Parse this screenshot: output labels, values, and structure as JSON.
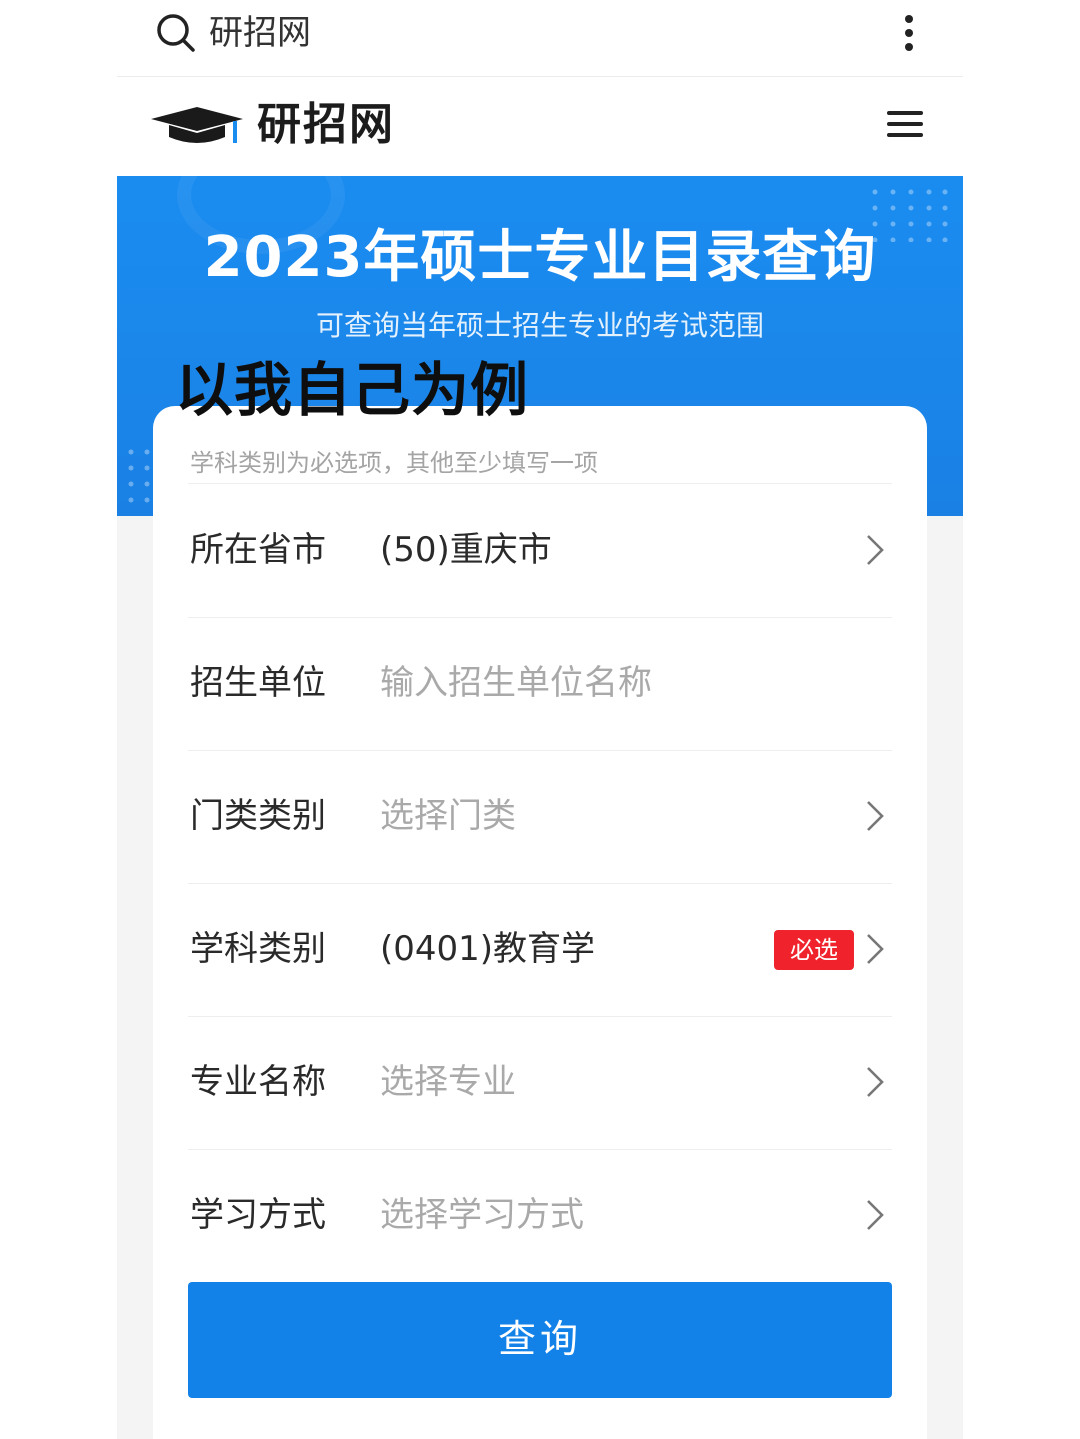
{
  "browser": {
    "search_text": "研招网"
  },
  "site": {
    "logo_text": "研招网"
  },
  "banner": {
    "title": "2023年硕士专业目录查询",
    "subtitle": "可查询当年硕士招生专业的考试范围"
  },
  "overlay_note": "以我自己为例",
  "form": {
    "hint": "学科类别为必选项，其他至少填写一项",
    "rows": [
      {
        "label": "所在省市",
        "value": "(50)重庆市",
        "placeholder": false
      },
      {
        "label": "招生单位",
        "value": "输入招生单位名称",
        "placeholder": true
      },
      {
        "label": "门类类别",
        "value": "选择门类",
        "placeholder": true
      },
      {
        "label": "学科类别",
        "value": "(0401)教育学",
        "placeholder": false,
        "badge": "必选"
      },
      {
        "label": "专业名称",
        "value": "选择专业",
        "placeholder": true
      },
      {
        "label": "学习方式",
        "value": "选择学习方式",
        "placeholder": true
      }
    ],
    "submit_label": "查询"
  },
  "colors": {
    "accent": "#1382e8",
    "banner": "#1a8cf0",
    "badge": "#f0232d"
  }
}
